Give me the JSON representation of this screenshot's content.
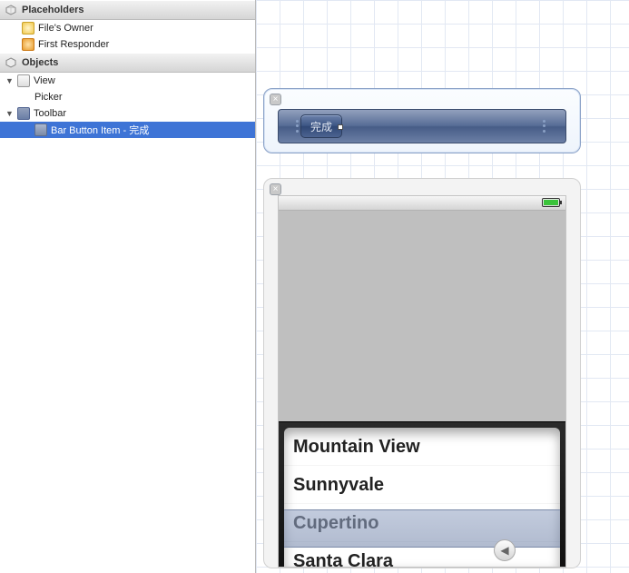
{
  "sidebar": {
    "placeholders_title": "Placeholders",
    "objects_title": "Objects",
    "files_owner": "File's Owner",
    "first_responder": "First Responder",
    "view": "View",
    "picker": "Picker",
    "toolbar": "Toolbar",
    "bar_button_item": "Bar Button Item - 完成"
  },
  "toolbar": {
    "done_label": "完成"
  },
  "picker": {
    "rows": [
      "Mountain View",
      "Sunnyvale",
      "Cupertino",
      "Santa Clara"
    ]
  }
}
